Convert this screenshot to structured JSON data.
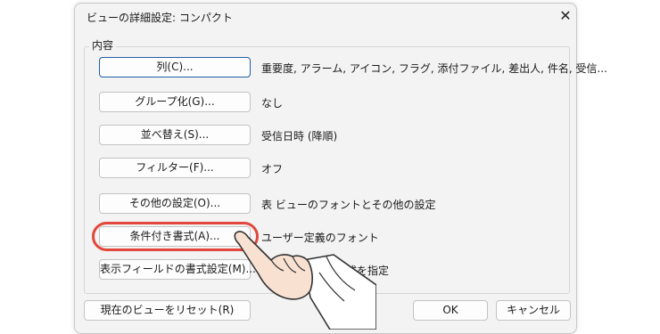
{
  "dialog": {
    "title": "ビューの詳細設定: コンパクト",
    "group_label": "内容",
    "rows": [
      {
        "label": "列(C)...",
        "value": "重要度, アラーム, アイコン, フラグ, 添付ファイル, 差出人, 件名, 受信..."
      },
      {
        "label": "グループ化(G)...",
        "value": "なし"
      },
      {
        "label": "並べ替え(S)...",
        "value": "受信日時 (降順)"
      },
      {
        "label": "フィルター(F)...",
        "value": "オフ"
      },
      {
        "label": "その他の設定(O)...",
        "value": "表 ビューのフォントとその他の設定"
      },
      {
        "label": "条件付き書式(A)...",
        "value": "ユーザー定義のフォント"
      },
      {
        "label": "表示フィールドの書式設定(M)...",
        "value": "示形式を指定"
      }
    ],
    "reset_label": "現在のビューをリセット(R)",
    "ok_label": "OK",
    "cancel_label": "キャンセル"
  },
  "icons": {
    "close": "close-icon",
    "pointer": "pointing-hand-icon"
  },
  "colors": {
    "highlight": "#e2463c",
    "focus_border": "#1f5fa8"
  }
}
